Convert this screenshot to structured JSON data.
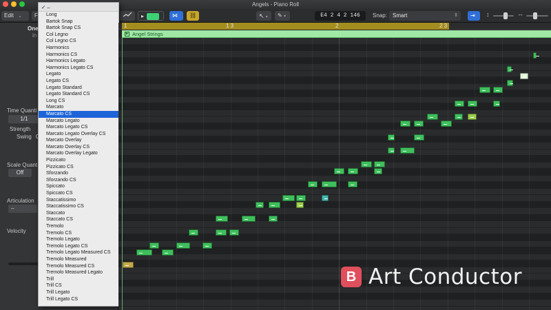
{
  "window": {
    "title": "Angels - Piano Roll"
  },
  "toolbar": {
    "edit_label": "Edit",
    "functions_label": "F",
    "position_display": "E4   2 4 2 146",
    "snap_label": "Snap:",
    "snap_value": "Smart",
    "pointer_tool": "pointer-tool-icon",
    "pencil_tool": "pencil-tool-icon"
  },
  "inspector": {
    "region_name": "One",
    "region_sub": "in",
    "time_quantize_label": "Time Quanti",
    "time_quantize_value": "1/1",
    "strength_label": "Strength",
    "swing_label": "Swing",
    "swing_value": "0",
    "scale_quantize_label": "Scale Quant",
    "scale_quantize_value": "Off",
    "articulation_label": "Articulation",
    "articulation_value": "–",
    "velocity_label": "Velocity"
  },
  "articulation_menu": {
    "current": "✓ –",
    "selected": "Marcato CS",
    "items": [
      "Long",
      "Bartok Snap",
      "Bartok Snap CS",
      "Col Legno",
      "Col Legno CS",
      "Harmonics",
      "Harmonics CS",
      "Harmonics Legato",
      "Harmonics Legato CS",
      "Legato",
      "Legato CS",
      "Legato Standard",
      "Legato Standard CS",
      "Long CS",
      "Marcato",
      "Marcato CS",
      "Marcato Legato",
      "Marcato Legato CS",
      "Marcato Legato Overlay CS",
      "Marcato Overlay",
      "Marcato Overlay CS",
      "Marcato Overlay Legato",
      "Pizzicato",
      "Pizzicato CS",
      "Sforzando",
      "Sforzando CS",
      "Spiccato",
      "Spiccato CS",
      "Staccatissimo",
      "Staccatissimo CS",
      "Staccato",
      "Staccato CS",
      "Tremolo",
      "Tremolo CS",
      "Tremolo Legato",
      "Tremolo Legato CS",
      "Tremolo Legato Measured CS",
      "Tremolo Measured",
      "Tremolo Measured CS",
      "Tremolo Measured Legato",
      "Trill",
      "Trill CS",
      "Trill Legato",
      "Trill Legato CS"
    ]
  },
  "ruler": {
    "marks": [
      "1",
      "1 3",
      "2",
      "2 3"
    ]
  },
  "region": {
    "name": "Angel Strings"
  },
  "colors": {
    "note_yellow": "#c3a94a",
    "note_green": "#3fbf5c",
    "note_light_green": "#9bcf4d",
    "note_teal": "#44b6ad",
    "note_white": "#e4f7dc",
    "cycle": "#a48d1f",
    "region": "#9fe8a6",
    "menu_highlight": "#1d64d8",
    "brand": "#e04f5c"
  },
  "watermark": {
    "logo_letter": "B",
    "text": "Art Conductor"
  }
}
